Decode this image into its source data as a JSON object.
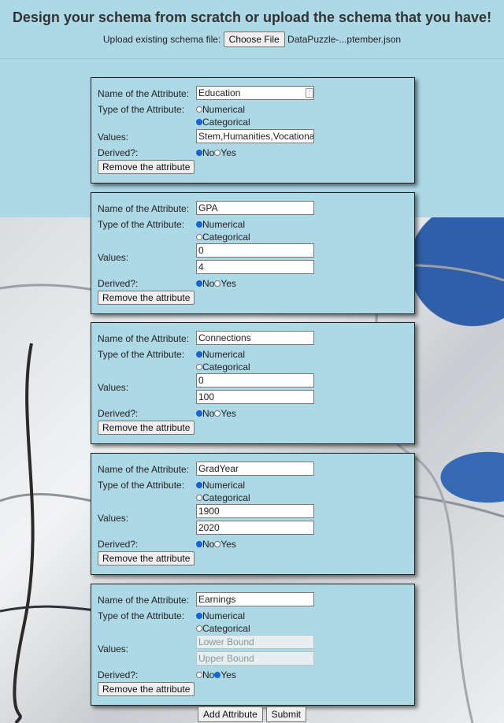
{
  "header": {
    "title": "Design your schema from scratch or upload the schema that you have!",
    "upload_label": "Upload existing schema file:",
    "choose_file_label": "Choose File",
    "file_name": "DataPuzzle-...ptember.json"
  },
  "labels": {
    "name": "Name of the Attribute:",
    "type": "Type of the Attribute:",
    "values": "Values:",
    "derived": "Derived?:",
    "numerical": "Numerical",
    "categorical": "Categorical",
    "no": "No",
    "yes": "Yes",
    "remove": "Remove the attribute"
  },
  "attributes": [
    {
      "name": "Education",
      "type": "categorical",
      "values": [
        "Stem,Humanities,Vocationa"
      ],
      "derived": "no"
    },
    {
      "name": "GPA",
      "type": "numerical",
      "values": [
        "0",
        "4"
      ],
      "derived": "no"
    },
    {
      "name": "Connections",
      "type": "numerical",
      "values": [
        "0",
        "100"
      ],
      "derived": "no"
    },
    {
      "name": "GradYear",
      "type": "numerical",
      "values": [
        "1900",
        "2020"
      ],
      "derived": "no"
    },
    {
      "name": "Earnings",
      "type": "numerical",
      "values": [],
      "placeholders": [
        "Lower Bound",
        "Upper Bound"
      ],
      "derived": "yes"
    }
  ],
  "footer": {
    "add_label": "Add Attribute",
    "submit_label": "Submit"
  }
}
